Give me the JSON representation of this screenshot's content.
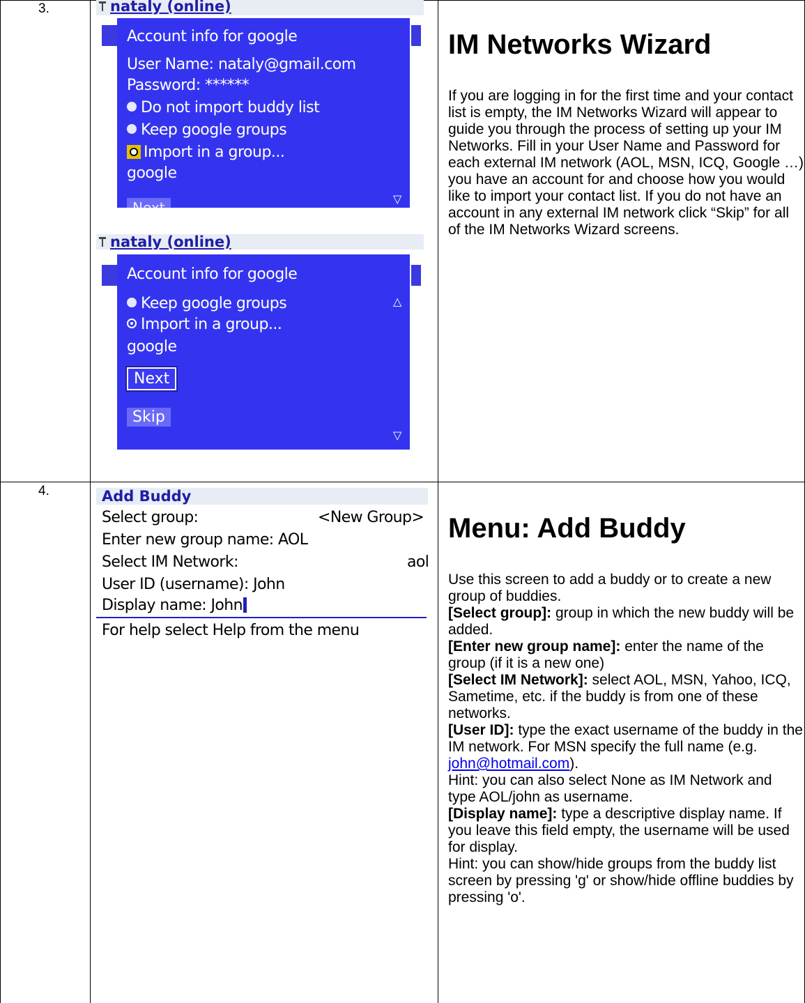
{
  "row3": {
    "number": "3.",
    "screen1": {
      "status_bar": "nataly (online)",
      "title": "Account info for google",
      "user_name": "User Name: nataly@gmail.com",
      "password": "Password: ******",
      "options": [
        "Do not import buddy list",
        "Keep google groups",
        "Import in a group..."
      ],
      "group_value": "google",
      "next_label": "Next"
    },
    "screen2": {
      "status_bar": "nataly (online)",
      "title": "Account info for google",
      "options": [
        "Keep google groups",
        "Import in a group..."
      ],
      "group_value": "google",
      "next_label": "Next",
      "skip_label": "Skip"
    },
    "heading": "IM Networks Wizard",
    "paragraph": "If you are logging in for the first time and your contact list is empty, the IM Networks Wizard will appear to guide you through the process of setting up your IM Networks. Fill in your User Name and Password for each external IM network (AOL, MSN, ICQ, Google …) you have an account for and choose how you would like to import your contact list. If you do not have an account in any external IM network click “Skip” for all of the IM Networks Wizard screens."
  },
  "row4": {
    "number": "4.",
    "screen": {
      "title": "Add Buddy",
      "select_group_label": "Select group:",
      "select_group_value": "<New Group>",
      "group_name": "Enter new group name: AOL",
      "network_label": "Select IM Network:",
      "network_value": "aol",
      "user_id": "User ID (username): John",
      "display_name": "Display name: John",
      "help": "For help select Help from the menu"
    },
    "heading": "Menu: Add Buddy",
    "intro": " Use this screen to add a buddy or to create a new group of buddies.",
    "items": [
      {
        "label": "[Select group]:",
        "text": " group in which the new buddy will be added."
      },
      {
        "label": "[Enter new group name]:",
        "text": " enter the name of the group (if it is a new one)"
      },
      {
        "label": "[Select IM Network]:",
        "text": " select AOL, MSN, Yahoo, ICQ, Sametime, etc. if the buddy is from one of these networks."
      }
    ],
    "user_id_label": "[User ID]:",
    "user_id_text": " type the exact username of the buddy in the IM network. For MSN specify the full name (e.g. ",
    "email_link": "john@hotmail.com",
    "user_id_end": ").",
    "hint1": " Hint: you can also select None as IM Network and type AOL/john as username.",
    "display_label": "[Display name]:",
    "display_text": " type a descriptive display name. If you leave this field empty, the username will be used for display.",
    "hint2": "Hint: you can show/hide groups from the buddy list screen by pressing 'g' or show/hide offline buddies by pressing 'o'."
  }
}
